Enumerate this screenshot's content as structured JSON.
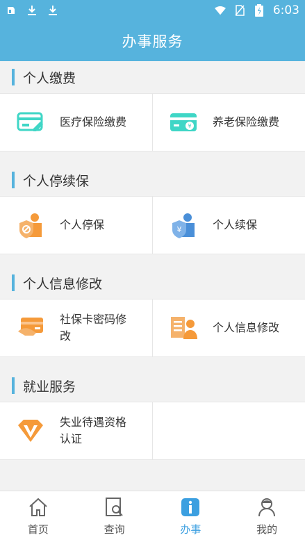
{
  "status_bar": {
    "time": "6:03"
  },
  "header": {
    "title": "办事服务"
  },
  "sections": [
    {
      "title": "个人缴费",
      "items": [
        {
          "label": "医疗保险缴费",
          "icon": "medical-card-icon"
        },
        {
          "label": "养老保险缴费",
          "icon": "pension-card-icon"
        }
      ]
    },
    {
      "title": "个人停续保",
      "items": [
        {
          "label": "个人停保",
          "icon": "stop-insurance-icon"
        },
        {
          "label": "个人续保",
          "icon": "renew-insurance-icon"
        }
      ]
    },
    {
      "title": "个人信息修改",
      "items": [
        {
          "label": "社保卡密码修改",
          "icon": "card-password-icon"
        },
        {
          "label": "个人信息修改",
          "icon": "personal-info-icon"
        }
      ]
    },
    {
      "title": "就业服务",
      "items": [
        {
          "label": "失业待遇资格认证",
          "icon": "unemployment-cert-icon"
        }
      ]
    }
  ],
  "bottom_nav": [
    {
      "label": "首页",
      "icon": "home-icon"
    },
    {
      "label": "查询",
      "icon": "search-doc-icon"
    },
    {
      "label": "办事",
      "icon": "info-icon",
      "active": true
    },
    {
      "label": "我的",
      "icon": "profile-icon"
    }
  ],
  "colors": {
    "primary": "#56b3dd",
    "active_nav": "#3b9fe0",
    "orange": "#f59a3a",
    "teal": "#3fd6c6",
    "blue": "#4a8fd8"
  }
}
